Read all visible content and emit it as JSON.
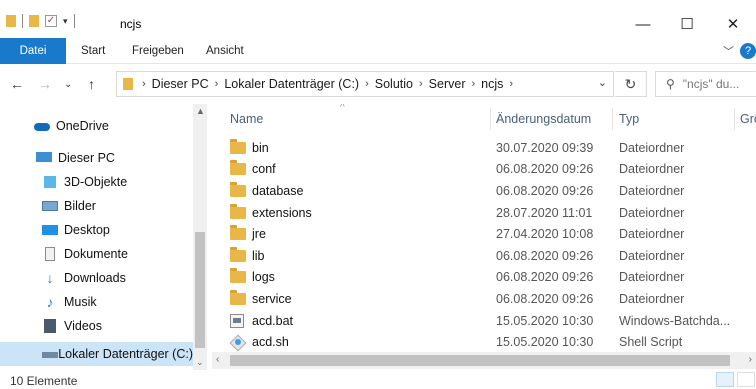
{
  "window": {
    "title": "ncjs",
    "minimize": "—",
    "maximize": "☐",
    "close": "✕"
  },
  "ribbon": {
    "tabs": [
      "Datei",
      "Start",
      "Freigeben",
      "Ansicht"
    ],
    "help": "?"
  },
  "address": {
    "crumbs": [
      "Dieser PC",
      "Lokaler Datenträger (C:)",
      "Solutio",
      "Server",
      "ncjs"
    ],
    "search_placeholder": "\"ncjs\" du..."
  },
  "sidebar": {
    "items": [
      {
        "label": "OneDrive",
        "icon": "cloud-icon"
      },
      {
        "label": "Dieser PC",
        "icon": "computer-icon"
      },
      {
        "label": "3D-Objekte",
        "icon": "cube-icon"
      },
      {
        "label": "Bilder",
        "icon": "pictures-icon"
      },
      {
        "label": "Desktop",
        "icon": "desktop-icon"
      },
      {
        "label": "Dokumente",
        "icon": "documents-icon"
      },
      {
        "label": "Downloads",
        "icon": "download-icon"
      },
      {
        "label": "Musik",
        "icon": "music-icon"
      },
      {
        "label": "Videos",
        "icon": "videos-icon"
      },
      {
        "label": "Lokaler Datenträger (C:)",
        "icon": "drive-icon"
      }
    ]
  },
  "columns": {
    "name": "Name",
    "date": "Änderungsdatum",
    "type": "Typ",
    "size": "Grö"
  },
  "files": [
    {
      "name": "bin",
      "date": "30.07.2020 09:39",
      "type": "Dateiordner",
      "icon": "folder-icon"
    },
    {
      "name": "conf",
      "date": "06.08.2020 09:26",
      "type": "Dateiordner",
      "icon": "folder-icon"
    },
    {
      "name": "database",
      "date": "06.08.2020 09:26",
      "type": "Dateiordner",
      "icon": "folder-icon"
    },
    {
      "name": "extensions",
      "date": "28.07.2020 11:01",
      "type": "Dateiordner",
      "icon": "folder-icon"
    },
    {
      "name": "jre",
      "date": "27.04.2020 10:08",
      "type": "Dateiordner",
      "icon": "folder-icon"
    },
    {
      "name": "lib",
      "date": "06.08.2020 09:26",
      "type": "Dateiordner",
      "icon": "folder-icon"
    },
    {
      "name": "logs",
      "date": "06.08.2020 09:26",
      "type": "Dateiordner",
      "icon": "folder-icon"
    },
    {
      "name": "service",
      "date": "06.08.2020 09:26",
      "type": "Dateiordner",
      "icon": "folder-icon"
    },
    {
      "name": "acd.bat",
      "date": "15.05.2020 10:30",
      "type": "Windows-Batchda...",
      "icon": "batch-file-icon"
    },
    {
      "name": "acd.sh",
      "date": "15.05.2020 10:30",
      "type": "Shell Script",
      "icon": "script-file-icon"
    }
  ],
  "status": {
    "count": "10 Elemente"
  },
  "colors": {
    "accent": "#1979ca",
    "selection": "#cce4f7",
    "folder": "#e9b648"
  }
}
